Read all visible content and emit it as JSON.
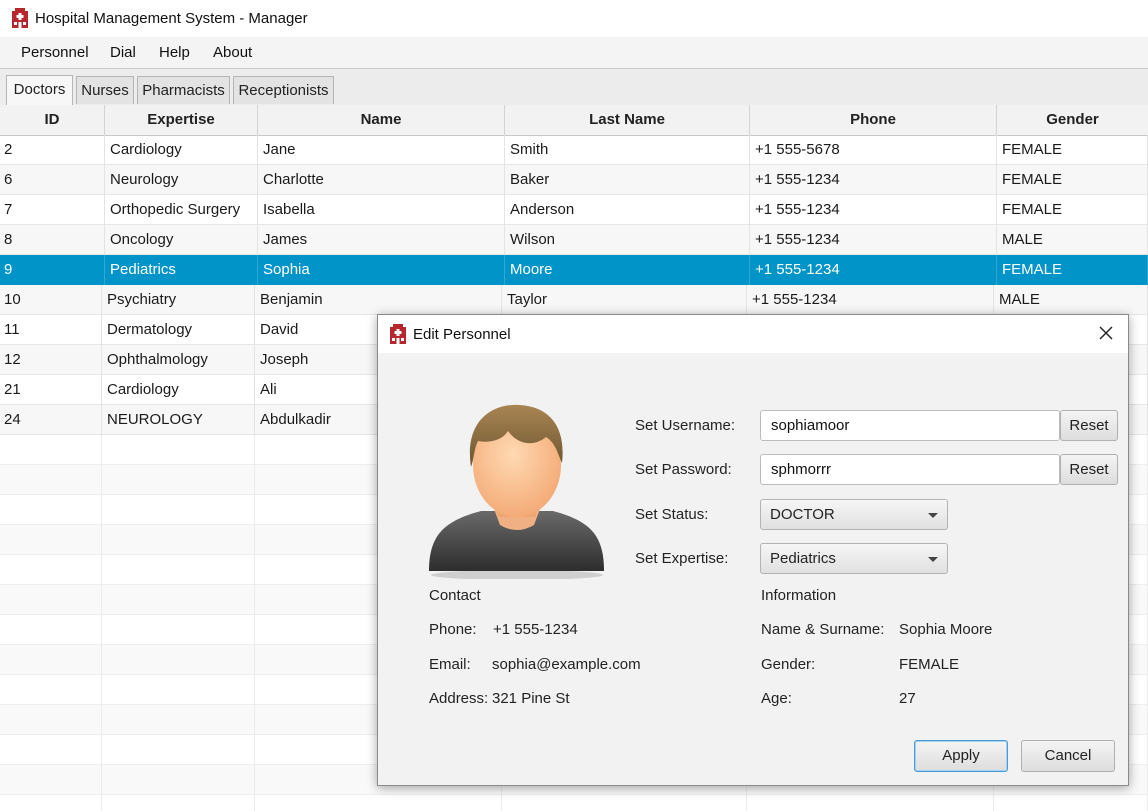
{
  "window": {
    "title": "Hospital Management System - Manager",
    "icon": "hospital-icon",
    "accent_color": "#b5272d"
  },
  "menubar": {
    "items": [
      "Personnel",
      "Dial",
      "Help",
      "About"
    ]
  },
  "tabs": {
    "items": [
      "Doctors",
      "Nurses",
      "Pharmacists",
      "Receptionists"
    ],
    "active": "Doctors"
  },
  "table": {
    "columns": [
      "ID",
      "Expertise",
      "Name",
      "Last Name",
      "Phone",
      "Gender"
    ],
    "selected_row_color": "#0094c8",
    "rows": [
      [
        "2",
        "Cardiology",
        "Jane",
        "Smith",
        "+1 555-5678",
        "FEMALE"
      ],
      [
        "6",
        "Neurology",
        "Charlotte",
        "Baker",
        "+1 555-1234",
        "FEMALE"
      ],
      [
        "7",
        "Orthopedic Surgery",
        "Isabella",
        "Anderson",
        "+1 555-1234",
        "FEMALE"
      ],
      [
        "8",
        "Oncology",
        "James",
        "Wilson",
        "+1 555-1234",
        "MALE"
      ],
      [
        "9",
        "Pediatrics",
        "Sophia",
        "Moore",
        "+1 555-1234",
        "FEMALE"
      ],
      [
        "10",
        "Psychiatry",
        "Benjamin",
        "Taylor",
        "+1 555-1234",
        "MALE"
      ],
      [
        "11",
        "Dermatology",
        "David",
        "",
        "",
        ""
      ],
      [
        "12",
        "Ophthalmology",
        "Joseph",
        "",
        "",
        ""
      ],
      [
        "21",
        "Cardiology",
        "Ali",
        "",
        "",
        ""
      ],
      [
        "24",
        "NEUROLOGY",
        "Abdulkadir",
        "",
        "",
        ""
      ]
    ],
    "selected_index": 4
  },
  "dialog": {
    "title": "Edit Personnel",
    "icon": "hospital-icon",
    "close_icon": "close-icon",
    "avatar_icon": "user-avatar-icon",
    "username": {
      "label": "Set Username:",
      "value": "sophiamoor",
      "reset": "Reset"
    },
    "password": {
      "label": "Set Password:",
      "value": "sphmorrr",
      "reset": "Reset"
    },
    "status": {
      "label": "Set Status:",
      "value": "DOCTOR"
    },
    "expertise": {
      "label": "Set Expertise:",
      "value": "Pediatrics"
    },
    "contact": {
      "heading": "Contact",
      "phone_label": "Phone:",
      "phone": "+1 555-1234",
      "email_label": "Email:",
      "email": "sophia@example.com",
      "address_label": "Address:",
      "address": "321 Pine St"
    },
    "information": {
      "heading": "Information",
      "name_label": "Name & Surname:",
      "name": "Sophia Moore",
      "gender_label": "Gender:",
      "gender": "FEMALE",
      "age_label": "Age:",
      "age": "27"
    },
    "apply_label": "Apply",
    "cancel_label": "Cancel"
  }
}
